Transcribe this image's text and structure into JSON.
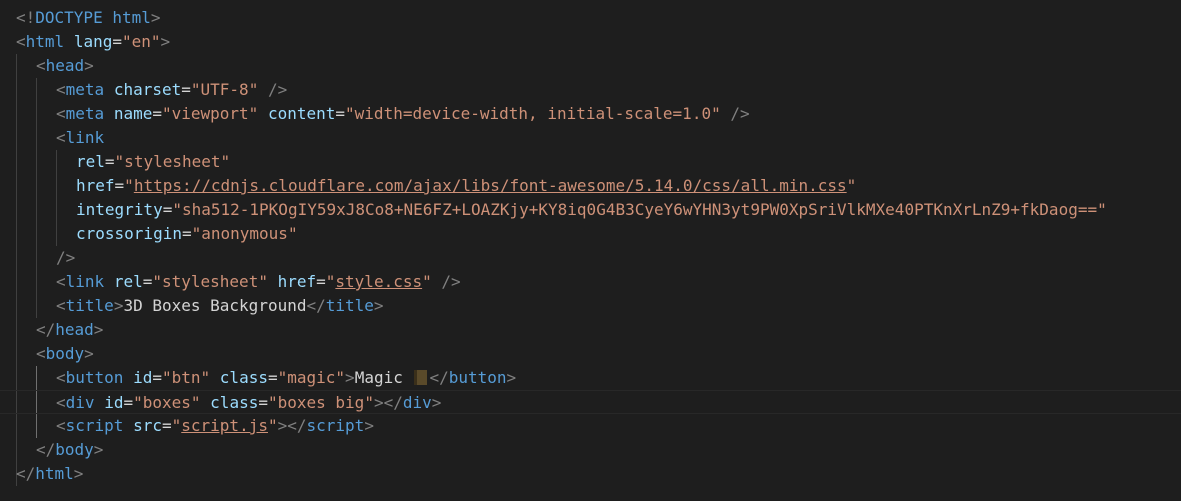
{
  "colors": {
    "background": "#1e1e1e",
    "punctuation": "#808080",
    "tag": "#569cd6",
    "attribute": "#9cdcfe",
    "value": "#ce9178",
    "text": "#d4d4d4"
  },
  "code": {
    "doctype": {
      "open": "<!",
      "keyword": "DOCTYPE",
      "name": "html",
      "close": ">"
    },
    "html_open": {
      "tag": "html",
      "attr": "lang",
      "eq": "=",
      "val": "\"en\""
    },
    "head_open": {
      "tag": "head"
    },
    "meta_charset": {
      "tag": "meta",
      "attr": "charset",
      "eq": "=",
      "val": "\"UTF-8\"",
      "close": " />"
    },
    "meta_viewport": {
      "tag": "meta",
      "attr1": "name",
      "val1": "\"viewport\"",
      "attr2": "content",
      "val2": "\"width=device-width, initial-scale=1.0\"",
      "close": " />"
    },
    "link_open": {
      "tag": "link"
    },
    "link_rel": {
      "attr": "rel",
      "eq": "=",
      "val": "\"stylesheet\""
    },
    "link_href": {
      "attr": "href",
      "eq": "=",
      "q1": "\"",
      "url": "https://cdnjs.cloudflare.com/ajax/libs/font-awesome/5.14.0/css/all.min.css",
      "q2": "\""
    },
    "link_integrity": {
      "attr": "integrity",
      "eq": "=",
      "val": "\"sha512-1PKOgIY59xJ8Co8+NE6FZ+LOAZKjy+KY8iq0G4B3CyeY6wYHN3yt9PW0XpSriVlkMXe40PTKnXrLnZ9+fkDaog==\""
    },
    "link_crossorigin": {
      "attr": "crossorigin",
      "eq": "=",
      "val": "\"anonymous\""
    },
    "link_close": {
      "close": "/>"
    },
    "link_style": {
      "tag": "link",
      "attr1": "rel",
      "val1": "\"stylesheet\"",
      "attr2": "href",
      "q1": "\"",
      "file": "style.css",
      "q2": "\"",
      "close": " />"
    },
    "title": {
      "tag": "title",
      "text": "3D Boxes Background",
      "end_tag": "title"
    },
    "head_close": {
      "tag": "head"
    },
    "body_open": {
      "tag": "body"
    },
    "button": {
      "tag": "button",
      "attr1": "id",
      "val1": "\"btn\"",
      "attr2": "class",
      "val2": "\"magic\"",
      "text": "Magic ",
      "end_tag": "button"
    },
    "div": {
      "tag": "div",
      "attr1": "id",
      "val1": "\"boxes\"",
      "attr2": "class",
      "val2": "\"boxes big\"",
      "end_tag": "div"
    },
    "script": {
      "tag": "script",
      "attr": "src",
      "eq": "=",
      "q1": "\"",
      "file": "script.js",
      "q2": "\"",
      "end_tag": "script"
    },
    "body_close": {
      "tag": "body"
    },
    "html_close": {
      "tag": "html"
    }
  }
}
